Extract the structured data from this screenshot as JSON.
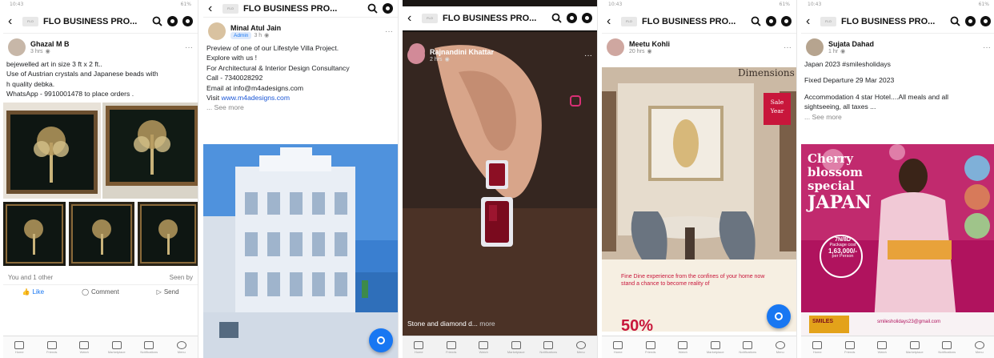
{
  "group_title": "FLO BUSINESS PRO...",
  "group_logo": "FLO",
  "status_time": "10:43",
  "status_right": "61%",
  "posts": [
    {
      "author": "Ghazal M B",
      "time": "3 hrs",
      "lines": [
        "bejewelled art in size 3 ft x 2 ft..",
        "Use of Austrian crystals and Japanese beads with",
        "h quality debka.",
        "WhatsApp - 9910001478 to place orders ."
      ],
      "reactions_left": "You and 1 other",
      "reactions_right": "Seen by",
      "like": "Like",
      "comment": "Comment",
      "send": "Send"
    },
    {
      "author": "Minal Atul Jain",
      "badge": "Admin",
      "time": "3 h",
      "lines": [
        "Preview of one of our Lifestyle Villa Project.",
        "Explore with us !",
        "For Architectural & Interior Design Consultancy",
        "Call - 7340028292",
        "Email at info@m4adesigns.com"
      ],
      "visit_label": "Visit",
      "visit_link": "www.m4adesigns.com",
      "see_more": "... See more"
    },
    {
      "author": "Rajnandini Khattar",
      "time": "2 hrs",
      "caption": "Stone and diamond d...",
      "more": "more"
    },
    {
      "author": "Meetu Kohli",
      "time": "20 hrs",
      "brand": "Dimensions",
      "sale": "Sale Year",
      "ad_text": "Fine Dine experience from the confines of your home now stand a chance to become reality of",
      "ad_big": "50%"
    },
    {
      "author": "Sujata Dahad",
      "time": "1 hr",
      "lines": [
        "Japan 2023 #smilesholidays",
        "Fixed Departure 29 Mar 2023",
        "Accommodation 4 star Hotel....All meals and all",
        "sightseeing, all taxes ..."
      ],
      "see_more": "... See more",
      "poster": {
        "line1": "Cherry",
        "line2": "blossom",
        "line3": "special",
        "line4": "JAPAN",
        "nights": "7N/8D",
        "package": "Package cost",
        "price": "1,63,000/-",
        "per": "per Person",
        "logo": "SMILES",
        "email": "smilesholidays23@gmail.com"
      }
    }
  ],
  "nav": [
    "Home",
    "Friends",
    "Watch",
    "Marketplace",
    "Notifications",
    "Menu"
  ],
  "colors": {
    "fb_blue": "#1877f2",
    "poster_pink": "#b0135e",
    "sale_red": "#c8163b"
  }
}
